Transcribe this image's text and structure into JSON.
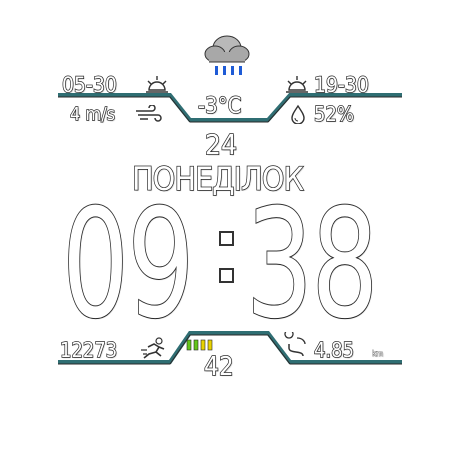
{
  "weather": {
    "icon": "rain-cloud-icon",
    "sunrise": "05-30",
    "sunset": "19-30",
    "wind": "4 m/s",
    "temperature": "-3°C",
    "humidity": "52%"
  },
  "date": {
    "day": "24",
    "weekday": "ПОНЕДІЛОК"
  },
  "time": {
    "hours": "09",
    "minutes": "38"
  },
  "activity": {
    "steps": "12273",
    "distance": "4.85",
    "distance_unit": "km",
    "battery_percent": "42",
    "battery_level": 0.42
  },
  "colors": {
    "accent_line": "#2f6e73",
    "battery_green": "#63c51a",
    "battery_yellow": "#e8d200"
  }
}
